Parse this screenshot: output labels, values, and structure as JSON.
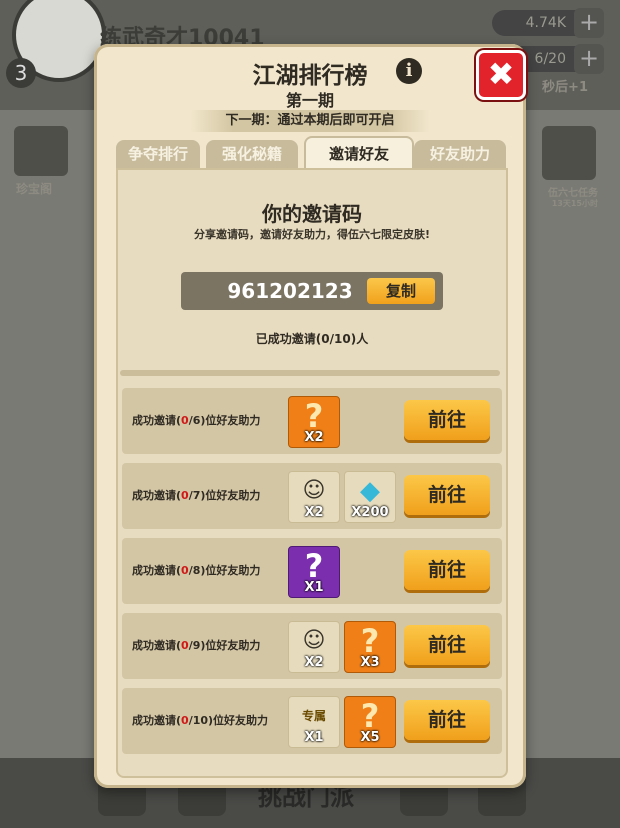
{
  "background": {
    "player_name": "练武奇才10041",
    "level": "3",
    "resource_1": "4.74K",
    "resource_2": "6/20",
    "timer_text": "秒后+1",
    "chest_label": "珍宝阁",
    "task_label": "伍六七任务",
    "task_time": "13天15小时",
    "bottom_title": "挑战门派"
  },
  "modal": {
    "title": "江湖排行榜",
    "subtitle": "第一期",
    "next_period": "下一期：通过本期后即可开启",
    "tabs": [
      {
        "label": "争夺排行",
        "active": false
      },
      {
        "label": "强化秘籍",
        "active": false
      },
      {
        "label": "邀请好友",
        "active": true
      },
      {
        "label": "好友助力",
        "active": false
      }
    ],
    "invite": {
      "heading": "你的邀请码",
      "description": "分享邀请码，邀请好友助力，得伍六七限定皮肤!",
      "code": "961202123",
      "copy_label": "复制",
      "invited_status": "已成功邀请(0/10)人"
    },
    "rows": [
      {
        "prefix": "成功邀请(",
        "current": "0",
        "rest": "/6)位好友助力",
        "rewards": [
          {
            "icon": "mystery-box-orange",
            "qty": "X2"
          }
        ],
        "button": "前往"
      },
      {
        "prefix": "成功邀请(",
        "current": "0",
        "rest": "/7)位好友助力",
        "rewards": [
          {
            "icon": "character-portrait",
            "qty": "X2"
          },
          {
            "icon": "gem",
            "qty": "X200"
          }
        ],
        "button": "前往"
      },
      {
        "prefix": "成功邀请(",
        "current": "0",
        "rest": "/8)位好友助力",
        "rewards": [
          {
            "icon": "mystery-box-purple",
            "qty": "X1"
          }
        ],
        "button": "前往"
      },
      {
        "prefix": "成功邀请(",
        "current": "0",
        "rest": "/9)位好友助力",
        "rewards": [
          {
            "icon": "character-portrait",
            "qty": "X2"
          },
          {
            "icon": "mystery-box-orange",
            "qty": "X3"
          }
        ],
        "button": "前往"
      },
      {
        "prefix": "成功邀请(",
        "current": "0",
        "rest": "/10)位好友助力",
        "rewards": [
          {
            "icon": "exclusive-badge",
            "label": "专属",
            "qty": "X1"
          },
          {
            "icon": "mystery-box-orange",
            "qty": "X5"
          }
        ],
        "button": "前往"
      }
    ]
  },
  "colors": {
    "modal_bg": "#f2e7cc",
    "button_orange": "#f0a01b",
    "close_red": "#e3232b",
    "progress_red": "#d01818"
  }
}
